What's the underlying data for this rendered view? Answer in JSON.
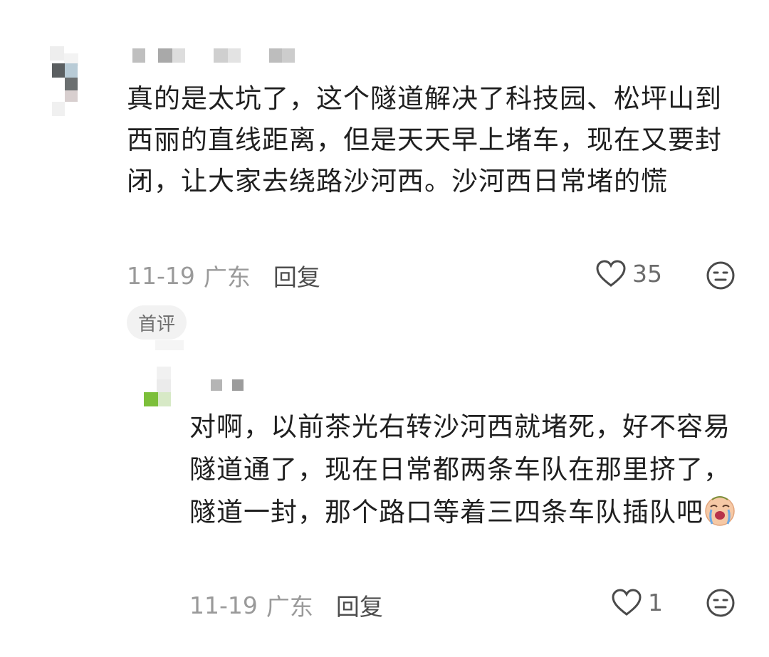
{
  "comment1": {
    "text": "真的是太坑了，这个隧道解决了科技园、松坪山到西丽的直线距离，但是天天早上堵车，现在又要封闭，让大家去绕路沙河西。沙河西日常堵的慌",
    "date": "11-19",
    "location": "广东",
    "reply_label": "回复",
    "likes": "35",
    "badge": "首评"
  },
  "comment2": {
    "text": "对啊，以前茶光右转沙河西就堵死，好不容易隧道通了，现在日常都两条车队在那里挤了，隧道一封，那个路口等着三四条车队插队吧",
    "emoji": "crying-face-emoji",
    "date": "11-19",
    "location": "广东",
    "reply_label": "回复",
    "likes": "1"
  },
  "icons": {
    "like": "heart-outline-icon",
    "dislike": "neutral-face-icon"
  },
  "colors": {
    "text": "#1f1f1f",
    "meta": "#9a9a9a",
    "badge_bg": "#f2f2f2"
  }
}
